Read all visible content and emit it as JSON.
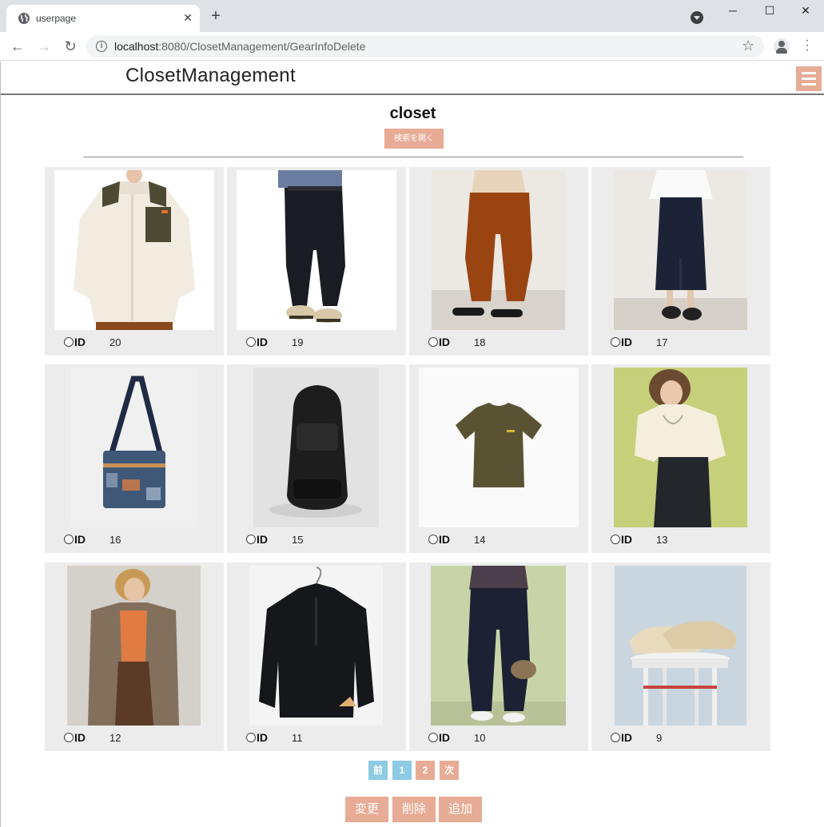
{
  "browser": {
    "tab_title": "userpage",
    "tab_close": "✕",
    "new_tab": "+",
    "url_host": "localhost",
    "url_path": ":8080/ClosetManagement/GearInfoDelete",
    "window_controls": {
      "minimize": "─",
      "maximize": "☐",
      "close": "✕"
    }
  },
  "header": {
    "title": "ClosetManagement"
  },
  "main": {
    "heading": "closet",
    "search_button": "検索を開く",
    "id_label": "ID",
    "items": [
      {
        "id": "20",
        "desc": "fleece jacket"
      },
      {
        "id": "19",
        "desc": "black pants"
      },
      {
        "id": "18",
        "desc": "brown corduroy pants"
      },
      {
        "id": "17",
        "desc": "denim skirt"
      },
      {
        "id": "16",
        "desc": "patchwork shoulder bag"
      },
      {
        "id": "15",
        "desc": "black backpack"
      },
      {
        "id": "14",
        "desc": "olive t-shirt"
      },
      {
        "id": "13",
        "desc": "cream blouse"
      },
      {
        "id": "12",
        "desc": "brown cardigan"
      },
      {
        "id": "11",
        "desc": "black anorak"
      },
      {
        "id": "10",
        "desc": "denim jeans"
      },
      {
        "id": "9",
        "desc": "beige sneakers"
      }
    ]
  },
  "pagination": {
    "prev": "前",
    "page1": "1",
    "page2": "2",
    "next": "次"
  },
  "actions": {
    "edit": "変更",
    "delete": "削除",
    "add": "追加"
  },
  "colors": {
    "accent": "#e8ab95",
    "pager_blue": "#8ccbe3",
    "card_bg": "#ececec"
  }
}
